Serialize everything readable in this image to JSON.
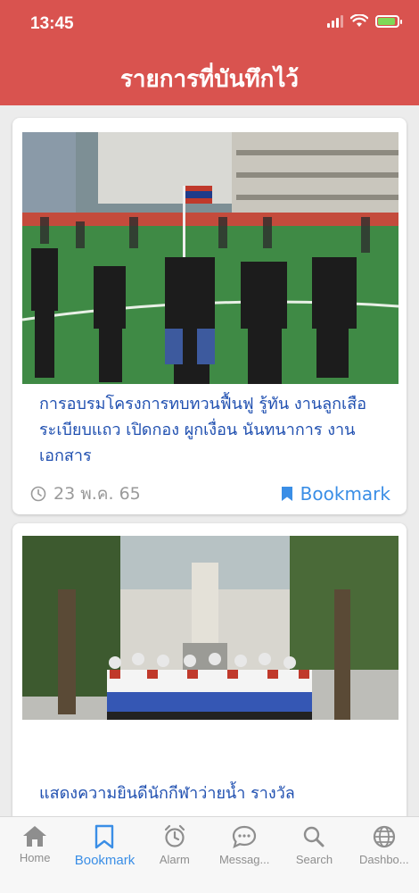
{
  "status_bar": {
    "time": "13:45"
  },
  "header": {
    "title": "รายการที่บันทึกไว้"
  },
  "cards": [
    {
      "title": "การอบรมโครงการทบทวนฟื้นฟู รู้ทัน งานลูกเสือ ระเบียบแถว เปิดกอง ผูกเงื่อน นันทนาการ งานเอกสาร",
      "date": "23 พ.ค. 65",
      "bookmark_label": "Bookmark"
    },
    {
      "title": "แสดงความยินดีนักกีฬาว่ายน้ำ รางวัล"
    }
  ],
  "tabs": [
    {
      "label": "Home",
      "icon": "home-icon"
    },
    {
      "label": "Bookmark",
      "icon": "bookmark-icon"
    },
    {
      "label": "Alarm",
      "icon": "alarm-icon"
    },
    {
      "label": "Messag...",
      "icon": "message-icon"
    },
    {
      "label": "Search",
      "icon": "search-icon"
    },
    {
      "label": "Dashbo...",
      "icon": "globe-icon"
    }
  ],
  "active_tab": "Bookmark",
  "colors": {
    "header": "#d9534f",
    "accent": "#3a8ee6",
    "title": "#1f4fb0"
  }
}
